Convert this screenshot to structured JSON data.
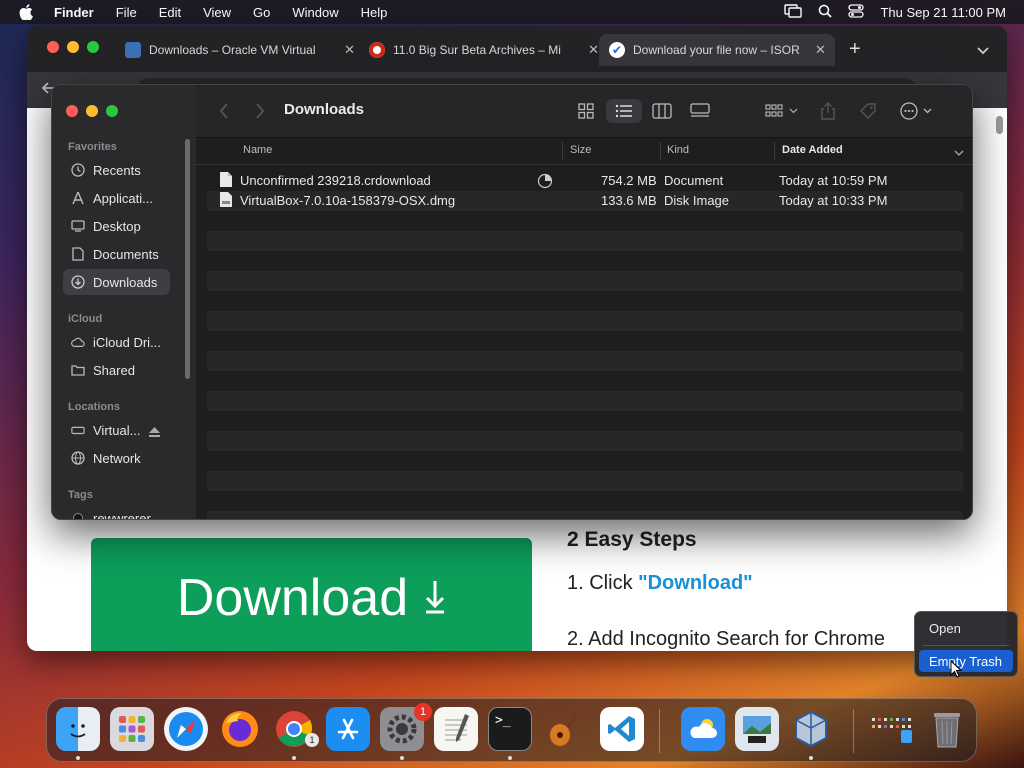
{
  "menubar": {
    "app_name": "Finder",
    "items": [
      "File",
      "Edit",
      "View",
      "Go",
      "Window",
      "Help"
    ],
    "clock": "Thu Sep 21  11:00 PM"
  },
  "browser": {
    "tabs": [
      {
        "label": "Downloads – Oracle VM Virtual",
        "icon": "virtualbox-icon"
      },
      {
        "label": "11.0 Big Sur Beta Archives – Mi",
        "icon": "opera-icon"
      },
      {
        "label": "Download your file now – ISOR",
        "icon": "check-icon"
      }
    ],
    "page": {
      "download_label": "Download",
      "steps_title": "2 Easy Steps",
      "step1_prefix": "1. Click ",
      "step1_link": "\"Download\"",
      "step2": "2. Add Incognito Search for Chrome"
    }
  },
  "finder": {
    "title": "Downloads",
    "sidebar": {
      "favorites_label": "Favorites",
      "favorites": [
        {
          "label": "Recents",
          "icon": "clock-icon"
        },
        {
          "label": "Applicati...",
          "icon": "applications-icon"
        },
        {
          "label": "Desktop",
          "icon": "desktop-icon"
        },
        {
          "label": "Documents",
          "icon": "document-icon"
        },
        {
          "label": "Downloads",
          "icon": "download-icon"
        }
      ],
      "icloud_label": "iCloud",
      "icloud": [
        {
          "label": "iCloud Dri...",
          "icon": "cloud-icon"
        },
        {
          "label": "Shared",
          "icon": "shared-folder-icon"
        }
      ],
      "locations_label": "Locations",
      "locations": [
        {
          "label": "Virtual...",
          "icon": "disk-icon"
        },
        {
          "label": "Network",
          "icon": "network-icon"
        }
      ],
      "tags_label": "Tags",
      "tags": [
        {
          "label": "rewwrerer",
          "icon": "tag-dot-icon"
        }
      ]
    },
    "columns": {
      "name": "Name",
      "size": "Size",
      "kind": "Kind",
      "date_added": "Date Added"
    },
    "files": [
      {
        "name": "Unconfirmed 239218.crdownload",
        "size": "754.2 MB",
        "kind": "Document",
        "date_added": "Today at 10:59 PM"
      },
      {
        "name": "VirtualBox-7.0.10a-158379-OSX.dmg",
        "size": "133.6 MB",
        "kind": "Disk Image",
        "date_added": "Today at 10:33 PM"
      }
    ]
  },
  "context_menu": {
    "items": [
      "Open",
      "Empty Trash"
    ],
    "highlighted": "Empty Trash"
  },
  "dock": {
    "apps": [
      "finder-icon",
      "launchpad-icon",
      "safari-icon",
      "firefox-icon",
      "chrome-icon",
      "app-store-icon",
      "system-settings-icon",
      "textedit-icon",
      "terminal-icon",
      "garageband-icon",
      "vscode-icon",
      "weather-icon",
      "preview-icon",
      "virtualbox-icon",
      "downloads-stack-icon",
      "trash-icon"
    ],
    "system_settings_badge": "1",
    "chrome_badge": "1"
  },
  "colors": {
    "download_button": "#0d9e5a",
    "link_blue": "#1d8fd6",
    "menu_highlight": "#1a5fd0",
    "badge_red": "#e5342a"
  }
}
